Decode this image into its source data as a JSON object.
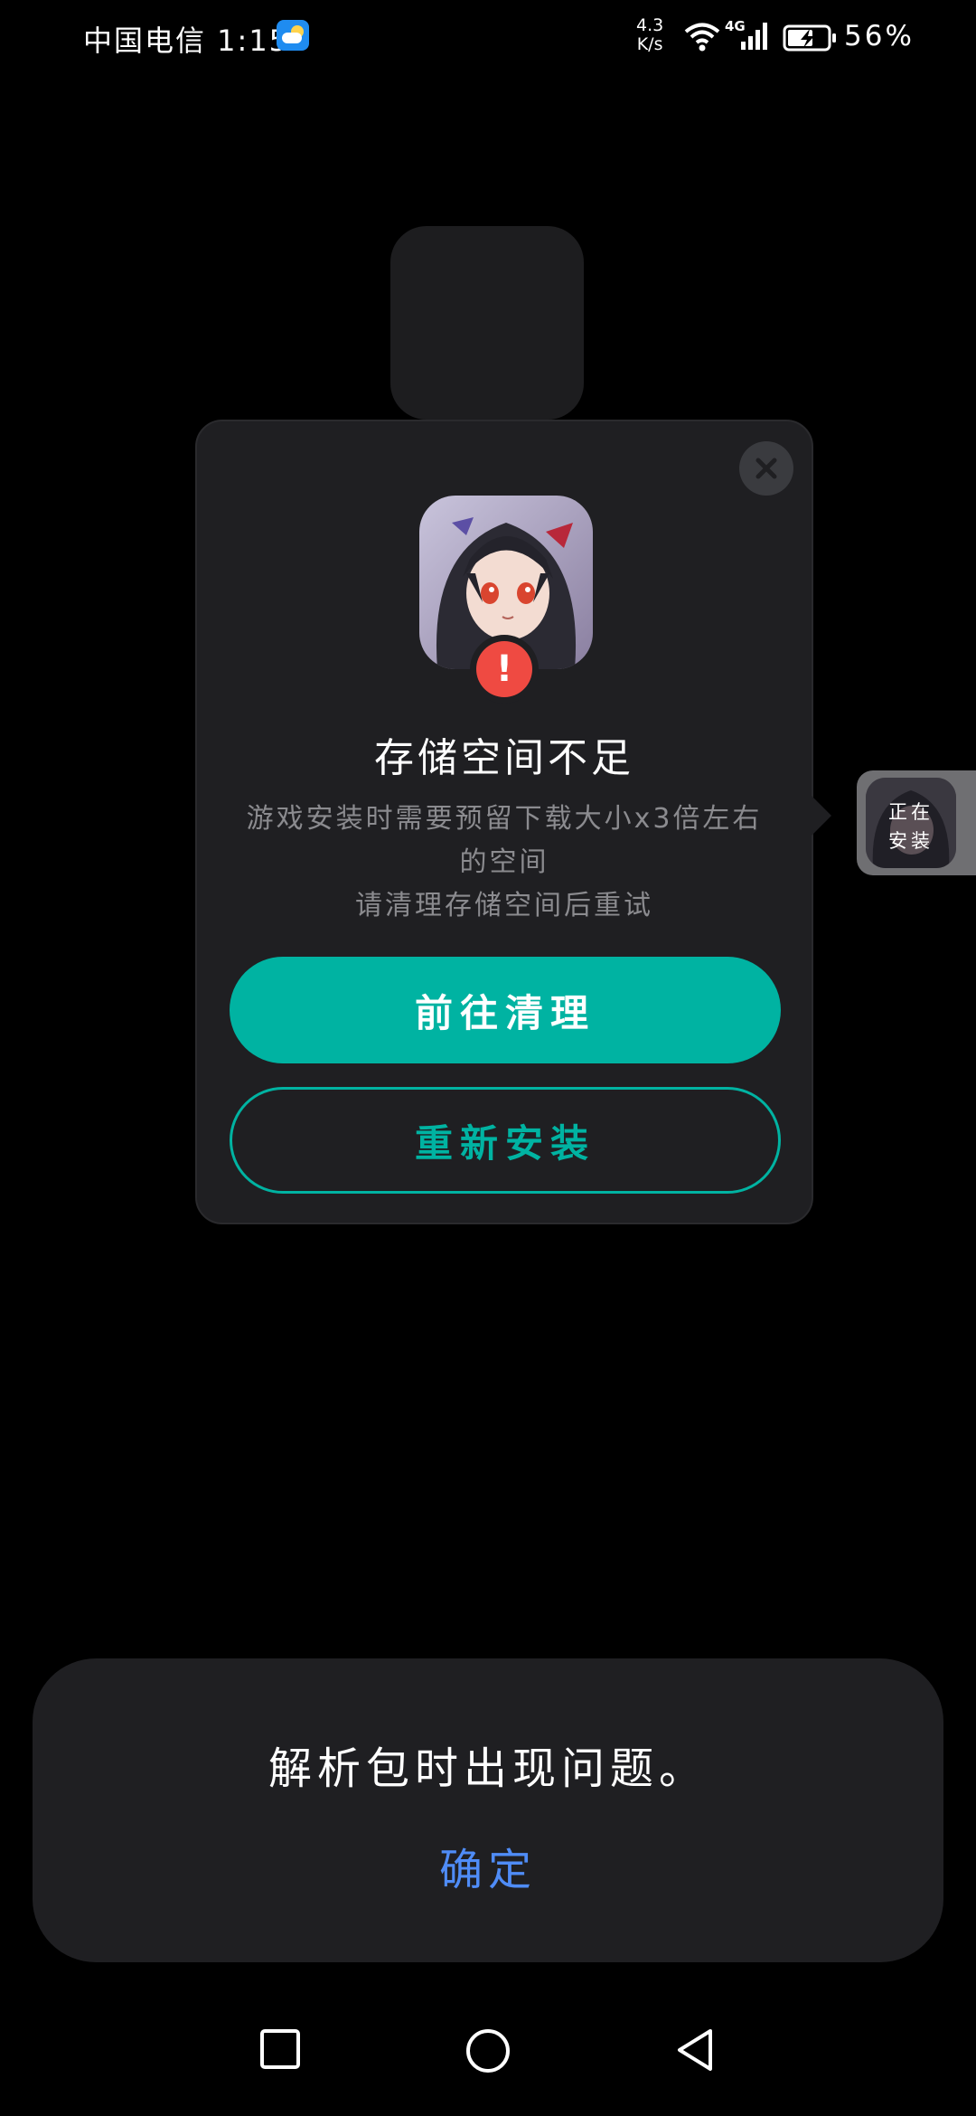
{
  "status_bar": {
    "carrier_time": "中国电信 1:15",
    "net_speed_value": "4.3",
    "net_speed_unit": "K/s",
    "network_type": "4G",
    "battery_percent": "56%",
    "icons": [
      "weather-icon",
      "wifi-icon",
      "signal-icon",
      "battery-charging-icon"
    ]
  },
  "dialog": {
    "title": "存储空间不足",
    "description_line1": "游戏安装时需要预留下载大小x3倍左右的空间",
    "description_line2": "请清理存储空间后重试",
    "primary_button": "前往清理",
    "secondary_button": "重新安装",
    "icons": [
      "close-icon",
      "warning-icon"
    ]
  },
  "side_widget": {
    "label_line1": "正在",
    "label_line2": "安装"
  },
  "bottom_sheet": {
    "message": "解析包时出现问题。",
    "confirm": "确定"
  },
  "nav_bar": {
    "icons": [
      "recent-apps-icon",
      "home-icon",
      "back-icon"
    ]
  },
  "colors": {
    "accent": "#00b3a2",
    "warning": "#ef4a42",
    "link": "#4f8cf7"
  }
}
